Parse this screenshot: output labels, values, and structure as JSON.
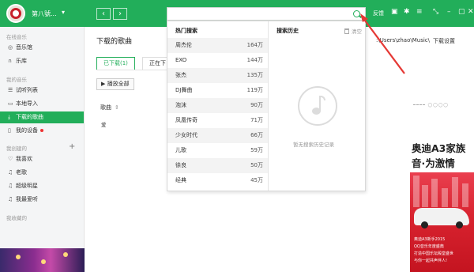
{
  "titlebar": {
    "username": "第八號...",
    "back_symbol": "‹",
    "forward_symbol": "›",
    "feedback": "反馈",
    "accent": "#22ae5a"
  },
  "search": {
    "value": "",
    "placeholder": ""
  },
  "sidebar": {
    "sections": [
      {
        "title": "在线音乐",
        "items": [
          {
            "icon": "music-hall-icon",
            "glyph": "◎",
            "label": "音乐馆"
          },
          {
            "icon": "library-icon",
            "glyph": "∩",
            "label": "乐库"
          }
        ]
      },
      {
        "title": "我的音乐",
        "items": [
          {
            "icon": "list-icon",
            "glyph": "☰",
            "label": "试听列表"
          },
          {
            "icon": "monitor-icon",
            "glyph": "▭",
            "label": "本地导入"
          },
          {
            "icon": "download-icon",
            "glyph": "⤓",
            "label": "下载的歌曲"
          },
          {
            "icon": "device-icon",
            "glyph": "▯",
            "label": "我的设备"
          }
        ]
      },
      {
        "title": "我创建的",
        "items": [
          {
            "icon": "heart-icon",
            "glyph": "♡",
            "label": "我喜欢"
          },
          {
            "icon": "note-icon",
            "glyph": "♫",
            "label": "老歌"
          },
          {
            "icon": "note-icon",
            "glyph": "♫",
            "label": "超级明星"
          },
          {
            "icon": "note-icon",
            "glyph": "♫",
            "label": "我最爱听"
          }
        ]
      },
      {
        "title": "我收藏的",
        "items": []
      }
    ],
    "add_symbol": "+"
  },
  "main": {
    "page_title": "下载的歌曲",
    "tabs": [
      "已下载(1)",
      "正在下"
    ],
    "play_all": "播放全部",
    "column_header": "歌曲",
    "row_text": "爱",
    "path": ":\\Users\\zhao\\Music\\",
    "download_settings": "下载设置"
  },
  "dropdown": {
    "hot_title": "热门搜索",
    "history_title": "搜索历史",
    "clear": "清空",
    "empty_text": "暂无搜索历史记录",
    "hot": [
      {
        "name": "周杰伦",
        "count": "164万"
      },
      {
        "name": "EXO",
        "count": "144万"
      },
      {
        "name": "张杰",
        "count": "135万"
      },
      {
        "name": "DJ舞曲",
        "count": "119万"
      },
      {
        "name": "泡沫",
        "count": "90万"
      },
      {
        "name": "凤凰传奇",
        "count": "71万"
      },
      {
        "name": "少女时代",
        "count": "66万"
      },
      {
        "name": "儿歌",
        "count": "59万"
      },
      {
        "name": "徐良",
        "count": "50万"
      },
      {
        "name": "经典",
        "count": "45万"
      }
    ]
  },
  "ad": {
    "title1": "奥迪A3家族",
    "title2": "音·为激情",
    "line1": "奥迪A3新手2015",
    "line2": "QQ音乐年度盛典",
    "line3": "打造中国乐坛殿堂盛世",
    "line4": "与你一起共声伴人!"
  }
}
